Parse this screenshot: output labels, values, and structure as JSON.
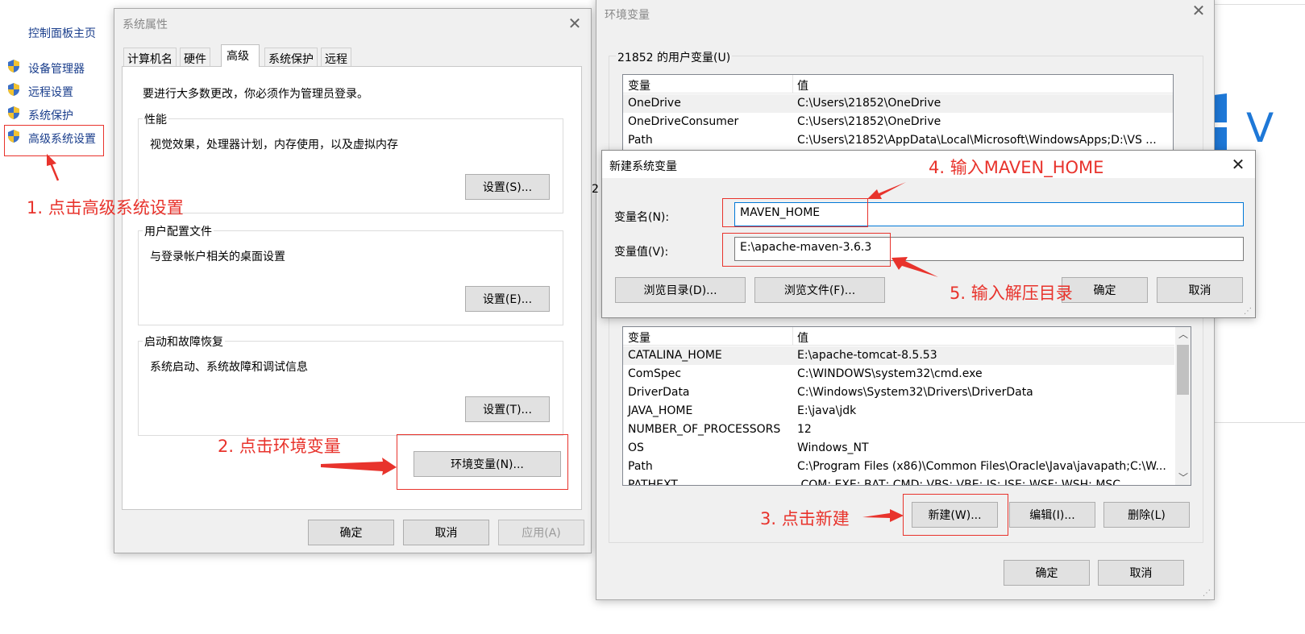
{
  "control_panel": {
    "home_link": "控制面板主页",
    "items": [
      {
        "label": "设备管理器"
      },
      {
        "label": "远程设置"
      },
      {
        "label": "系统保护"
      },
      {
        "label": "高级系统设置"
      }
    ]
  },
  "sys_props": {
    "title": "系统属性",
    "tabs": [
      "计算机名",
      "硬件",
      "高级",
      "系统保护",
      "远程"
    ],
    "admin_note": "要进行大多数更改，你必须作为管理员登录。",
    "performance": {
      "label": "性能",
      "desc": "视觉效果，处理器计划，内存使用，以及虚拟内存",
      "button": "设置(S)..."
    },
    "profiles": {
      "label": "用户配置文件",
      "desc": "与登录帐户相关的桌面设置",
      "button": "设置(E)..."
    },
    "startup": {
      "label": "启动和故障恢复",
      "desc": "系统启动、系统故障和调试信息",
      "button": "设置(T)..."
    },
    "env_button": "环境变量(N)...",
    "ok": "确定",
    "cancel": "取消",
    "apply": "应用(A)"
  },
  "env_vars": {
    "title": "环境变量",
    "user_group": "21852 的用户变量(U)",
    "col_var": "变量",
    "col_val": "值",
    "user_rows": [
      {
        "name": "OneDrive",
        "value": "C:\\Users\\21852\\OneDrive"
      },
      {
        "name": "OneDriveConsumer",
        "value": "C:\\Users\\21852\\OneDrive"
      },
      {
        "name": "Path",
        "value": "C:\\Users\\21852\\AppData\\Local\\Microsoft\\WindowsApps;D:\\VS ..."
      }
    ],
    "sys_peek": "2",
    "sys_rows": [
      {
        "name": "CATALINA_HOME",
        "value": "E:\\apache-tomcat-8.5.53"
      },
      {
        "name": "ComSpec",
        "value": "C:\\WINDOWS\\system32\\cmd.exe"
      },
      {
        "name": "DriverData",
        "value": "C:\\Windows\\System32\\Drivers\\DriverData"
      },
      {
        "name": "JAVA_HOME",
        "value": "E:\\java\\jdk"
      },
      {
        "name": "NUMBER_OF_PROCESSORS",
        "value": "12"
      },
      {
        "name": "OS",
        "value": "Windows_NT"
      },
      {
        "name": "Path",
        "value": "C:\\Program Files (x86)\\Common Files\\Oracle\\Java\\javapath;C:\\W..."
      },
      {
        "name": "PATHEXT",
        "value": ".COM;.EXE;.BAT;.CMD;.VBS;.VBE;.JS;.JSE;.WSF;.WSH;.MSC"
      }
    ],
    "new_button": "新建(W)...",
    "edit_button": "编辑(I)...",
    "delete_button": "删除(L)",
    "ok": "确定",
    "cancel": "取消"
  },
  "new_var": {
    "title": "新建系统变量",
    "name_label": "变量名(N):",
    "name_value": "MAVEN_HOME",
    "value_label": "变量值(V):",
    "value_value": "E:\\apache-maven-3.6.3",
    "browse_dir": "浏览目录(D)...",
    "browse_file": "浏览文件(F)...",
    "ok": "确定",
    "cancel": "取消"
  },
  "annotations": {
    "step1": "1.  点击高级系统设置",
    "step2": "2.  点击环境变量",
    "step3": "3.  点击新建",
    "step4": "4.  输入MAVEN_HOME",
    "step5": "5.  输入解压目录",
    "color": "#e8332c"
  }
}
